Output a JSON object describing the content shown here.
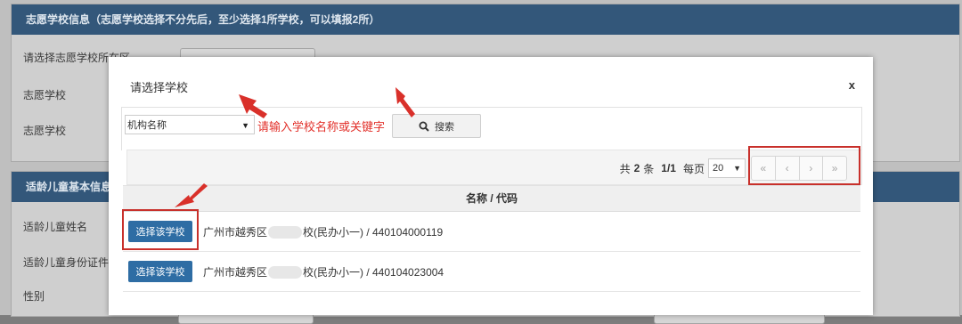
{
  "background_page": {
    "section1_title": "志愿学校信息（志愿学校选择不分先后，至少选择1所学校，可以填报2所）",
    "rows1": [
      "请选择志愿学校所在区",
      "志愿学校",
      "志愿学校"
    ],
    "section2_title": "适龄儿童基本信息",
    "rows2": [
      "适龄儿童姓名",
      "适龄儿童身份证件",
      "性别"
    ]
  },
  "modal": {
    "title": "请选择学校",
    "close_label": "x",
    "search": {
      "type_value": "机构名称",
      "type_caret": "▼",
      "input_value": "请输入学校名称或关键字",
      "button_label": "搜索"
    },
    "pager": {
      "prefix": "共",
      "total": "2",
      "total_unit": "条",
      "page": "1/1",
      "per_page_label": "每页",
      "page_size": "20",
      "page_size_caret": "▼",
      "first": "«",
      "prev": "‹",
      "next": "›",
      "last": "»"
    },
    "table": {
      "header": "名称 / 代码",
      "rows": [
        {
          "button": "选择该学校",
          "name_prefix": "广州市越秀区",
          "name_suffix": "校(民办小一) / 440104000119"
        },
        {
          "button": "选择该学校",
          "name_prefix": "广州市越秀区",
          "name_suffix": "校(民办小一) / 440104023004"
        }
      ]
    }
  },
  "colors": {
    "primary_button": "#2e6da4",
    "annotation_red": "#c8302b",
    "header_bar": "#33577a"
  }
}
